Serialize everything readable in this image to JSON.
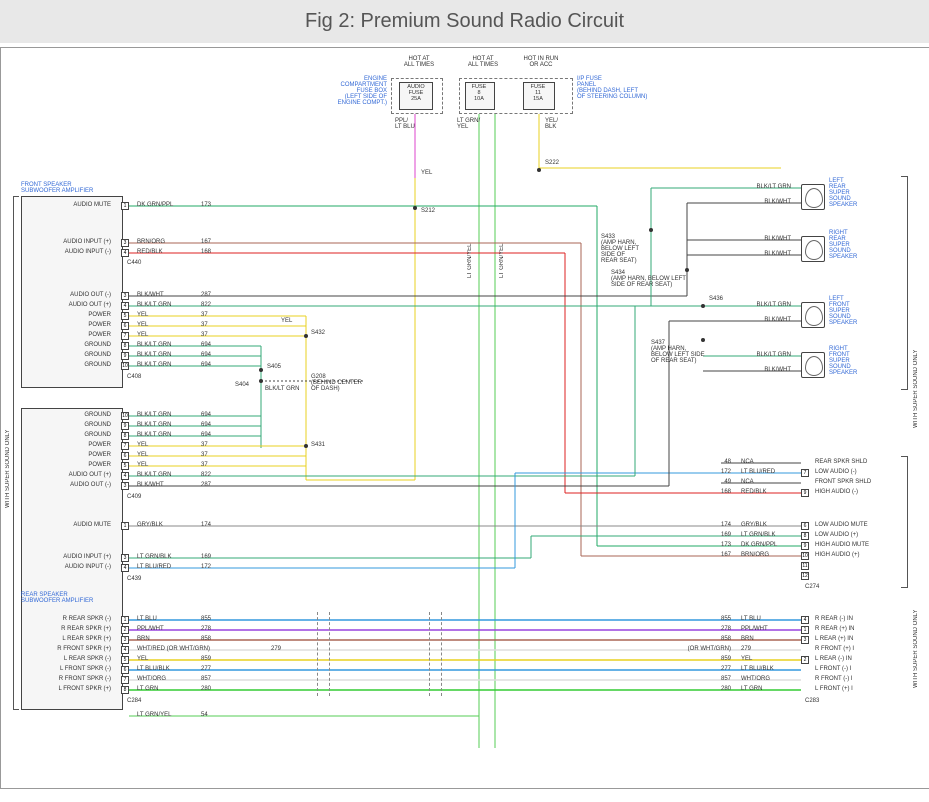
{
  "title": "Fig 2: Premium Sound Radio Circuit",
  "top_labels": {
    "hot1": "HOT AT\nALL TIMES",
    "hot2": "HOT AT\nALL TIMES",
    "hot3": "HOT IN RUN\nOR ACC",
    "engine": "ENGINE\nCOMPARTMENT\nFUSE BOX\n(LEFT SIDE OF\nENGINE COMPT.)",
    "ipfuse": "I/P FUSE\nPANEL\n(BEHIND DASH, LEFT\nOF STEERING COLUMN)",
    "audio_fuse": "AUDIO\nFUSE\n25A",
    "fuse8": "FUSE\n8\n10A",
    "fuse11": "FUSE\n11\n15A",
    "ppl_ltblu": "PPL/\nLT BLU",
    "ltgrnyel": "LT GRN/\nYEL",
    "yelblk": "YEL/\nBLK"
  },
  "left_components": {
    "front_amp": "FRONT SPEAKER\nSUBWOOFER AMPLIFIER",
    "rear_amp": "REAR SPEAKER\nSUBWOOFER AMPLIFIER",
    "side_label": "WITH SUPER SOUND ONLY"
  },
  "front_amp_pins": [
    {
      "n": "1",
      "lbl": "AUDIO MUTE",
      "wire": "DK GRN/PPL",
      "num": "173"
    },
    {
      "n": "3",
      "lbl": "AUDIO INPUT (+)",
      "wire": "BRN/ORG",
      "num": "167"
    },
    {
      "n": "4",
      "lbl": "AUDIO INPUT (-)",
      "wire": "RED/BLK",
      "num": "168"
    },
    {
      "n": "",
      "lbl": "",
      "wire": "C440",
      "num": ""
    },
    {
      "n": "3",
      "lbl": "AUDIO OUT (-)",
      "wire": "BLK/WHT",
      "num": "287"
    },
    {
      "n": "4",
      "lbl": "AUDIO OUT (+)",
      "wire": "BLK/LT GRN",
      "num": "822"
    },
    {
      "n": "5",
      "lbl": "POWER",
      "wire": "YEL",
      "num": "37"
    },
    {
      "n": "6",
      "lbl": "POWER",
      "wire": "YEL",
      "num": "37"
    },
    {
      "n": "7",
      "lbl": "POWER",
      "wire": "YEL",
      "num": "37"
    },
    {
      "n": "8",
      "lbl": "GROUND",
      "wire": "BLK/LT GRN",
      "num": "694"
    },
    {
      "n": "9",
      "lbl": "GROUND",
      "wire": "BLK/LT GRN",
      "num": "694"
    },
    {
      "n": "10",
      "lbl": "GROUND",
      "wire": "BLK/LT GRN",
      "num": "694"
    },
    {
      "n": "",
      "lbl": "",
      "wire": "C408",
      "num": ""
    }
  ],
  "rear_amp_pins_a": [
    {
      "n": "10",
      "lbl": "GROUND",
      "wire": "BLK/LT GRN",
      "num": "694"
    },
    {
      "n": "9",
      "lbl": "GROUND",
      "wire": "BLK/LT GRN",
      "num": "694"
    },
    {
      "n": "8",
      "lbl": "GROUND",
      "wire": "BLK/LT GRN",
      "num": "694"
    },
    {
      "n": "7",
      "lbl": "POWER",
      "wire": "YEL",
      "num": "37"
    },
    {
      "n": "6",
      "lbl": "POWER",
      "wire": "YEL",
      "num": "37"
    },
    {
      "n": "5",
      "lbl": "POWER",
      "wire": "YEL",
      "num": "37"
    },
    {
      "n": "4",
      "lbl": "AUDIO OUT (+)",
      "wire": "BLK/LT GRN",
      "num": "822"
    },
    {
      "n": "3",
      "lbl": "AUDIO OUT (-)",
      "wire": "BLK/WHT",
      "num": "287"
    },
    {
      "n": "",
      "lbl": "",
      "wire": "C409",
      "num": ""
    }
  ],
  "rear_amp_pins_b": [
    {
      "n": "1",
      "lbl": "AUDIO MUTE",
      "wire": "GRY/BLK",
      "num": "174"
    },
    {
      "n": "3",
      "lbl": "AUDIO INPUT (+)",
      "wire": "LT GRN/BLK",
      "num": "169"
    },
    {
      "n": "4",
      "lbl": "AUDIO INPUT (-)",
      "wire": "LT BLU/RED",
      "num": "172"
    },
    {
      "n": "",
      "lbl": "",
      "wire": "C439",
      "num": ""
    }
  ],
  "bottom_pins": [
    {
      "n": "1",
      "lbl": "R REAR SPKR (-)",
      "wire": "LT BLU",
      "num": "855"
    },
    {
      "n": "2",
      "lbl": "R REAR SPKR (+)",
      "wire": "PPL/WHT",
      "num": "278"
    },
    {
      "n": "3",
      "lbl": "L REAR SPKR (+)",
      "wire": "BRN",
      "num": "858"
    },
    {
      "n": "4",
      "lbl": "R FRONT SPKR (+)",
      "wire": "WHT/RED   (OR WHT/GRN)",
      "num": "279"
    },
    {
      "n": "5",
      "lbl": "L REAR SPKR (-)",
      "wire": "YEL",
      "num": "859"
    },
    {
      "n": "6",
      "lbl": "L FRONT SPKR (-)",
      "wire": "LT BLU/BLK",
      "num": "277"
    },
    {
      "n": "7",
      "lbl": "R FRONT SPKR (-)",
      "wire": "WHT/ORG",
      "num": "857"
    },
    {
      "n": "8",
      "lbl": "L FRONT SPKR (+)",
      "wire": "LT GRN",
      "num": "280"
    },
    {
      "n": "",
      "lbl": "",
      "wire": "C284",
      "num": ""
    },
    {
      "n": "",
      "lbl": "",
      "wire": "LT GRN/YEL",
      "num": "54"
    }
  ],
  "right_c274": [
    {
      "n": "48",
      "wire": "NCA",
      "lbl": "REAR SPKR SHLD"
    },
    {
      "n": "7",
      "wire": "LT BLU/RED",
      "num": "172",
      "lbl": "LOW AUDIO (-)"
    },
    {
      "n": "49",
      "wire": "NCA",
      "lbl": "FRONT SPKR SHLD"
    },
    {
      "n": "9",
      "wire": "RED/BLK",
      "num": "168",
      "lbl": "HIGH AUDIO (-)"
    },
    {
      "n": "6",
      "wire": "GRY/BLK",
      "num": "174",
      "lbl": "LOW AUDIO MUTE"
    },
    {
      "n": "8",
      "wire": "LT GRN/BLK",
      "num": "169",
      "lbl": "LOW AUDIO (+)"
    },
    {
      "n": "9",
      "wire": "DK GRN/PPL",
      "num": "173",
      "lbl": "HIGH AUDIO MUTE"
    },
    {
      "n": "10",
      "wire": "BRN/ORG",
      "num": "167",
      "lbl": "HIGH AUDIO (+)"
    },
    {
      "n": "11",
      "wire": "",
      "lbl": ""
    },
    {
      "n": "12",
      "wire": "",
      "lbl": ""
    }
  ],
  "right_c283": [
    {
      "n": "4",
      "wire": "LT BLU",
      "num": "855",
      "lbl": "R REAR (-) IN"
    },
    {
      "n": "1",
      "wire": "PPL/WHT",
      "num": "278",
      "lbl": "R REAR (+) IN"
    },
    {
      "n": "3",
      "wire": "BRN",
      "num": "858",
      "lbl": "L REAR (+) IN"
    },
    {
      "n": "",
      "wire": "(OR WHT/GRN)",
      "num": "279",
      "lbl": "R FRONT (+) I"
    },
    {
      "n": "2",
      "wire": "YEL",
      "num": "859",
      "lbl": "L REAR (-) IN"
    },
    {
      "n": "",
      "wire": "LT BLU/BLK",
      "num": "277",
      "lbl": "L FRONT (-) I"
    },
    {
      "n": "",
      "wire": "WHT/ORG",
      "num": "857",
      "lbl": "R FRONT (-) I"
    },
    {
      "n": "",
      "wire": "LT GRN",
      "num": "280",
      "lbl": "L FRONT (+) I"
    }
  ],
  "speakers": [
    {
      "name": "LEFT\nREAR\nSUPER\nSOUND\nSPEAKER",
      "w1": "BLK/LT GRN",
      "w2": "BLK/WHT"
    },
    {
      "name": "RIGHT\nREAR\nSUPER\nSOUND\nSPEAKER",
      "w1": "BLK/WHT",
      "w2": "BLK/WHT"
    },
    {
      "name": "LEFT\nFRONT\nSUPER\nSOUND\nSPEAKER",
      "w1": "BLK/LT GRN",
      "w2": "BLK/WHT"
    },
    {
      "name": "RIGHT\nFRONT\nSUPER\nSOUND\nSPEAKER",
      "w1": "BLK/LT GRN",
      "w2": "BLK/WHT"
    }
  ],
  "splices": {
    "s212": "S212",
    "s222": "S222",
    "s404": "S404",
    "s405": "S405",
    "s431": "S431",
    "s432": "S432",
    "s433": "S433\n(AMP HARN,\nBELOW LEFT\nSIDE OF\nREAR SEAT)",
    "s434": "S434\n(AMP HARN, BELOW LEFT\nSIDE OF REAR SEAT)",
    "s436": "S436",
    "s437": "S437\n(AMP HARN,\nBELOW LEFT SIDE\nOF REAR SEAT)",
    "g208": "G208\n(BEHIND CENTER\nOF DASH)"
  },
  "misc": {
    "c274": "C274",
    "c283": "C283",
    "c284": "C284",
    "c408": "C408",
    "c409": "C409",
    "c439": "C439",
    "c440": "C440",
    "yel": "YEL",
    "blkltgrn": "BLK/LT GRN",
    "wsso": "WITH SUPER SOUND ONLY",
    "ltgrnyel_v": "LT GRN/YEL"
  }
}
